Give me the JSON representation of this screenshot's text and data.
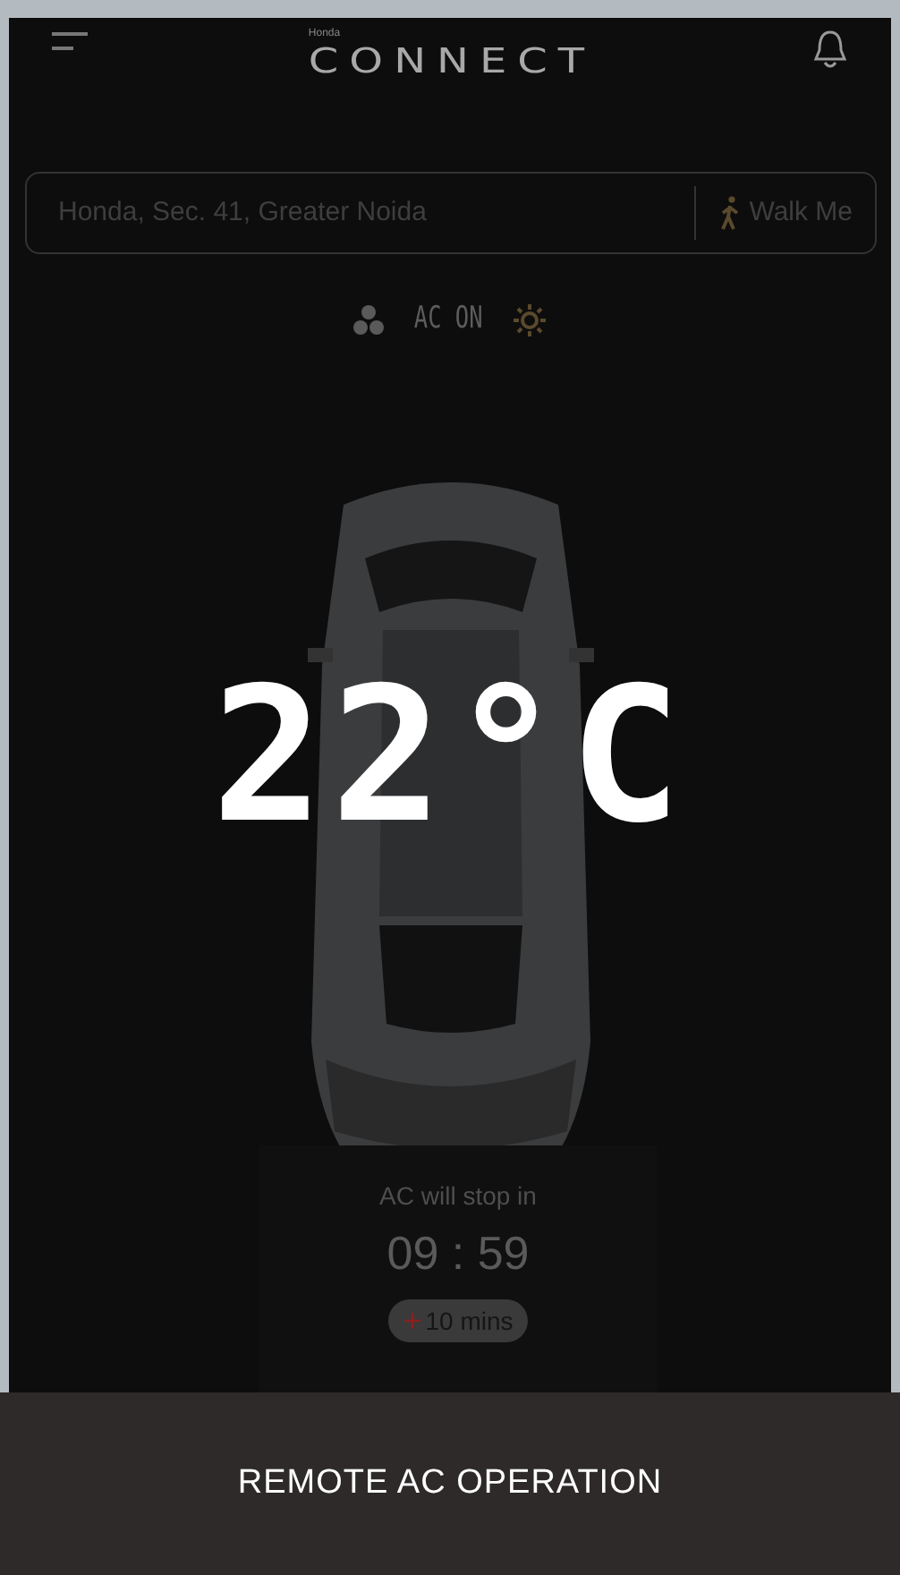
{
  "header": {
    "logo_small": "Honda",
    "logo": "CONNECT"
  },
  "location": {
    "address": "Honda, Sec. 41, Greater Noida",
    "walk_label": "Walk Me"
  },
  "ac_status": {
    "label": "AC ON",
    "on": true
  },
  "temperature": "22°C",
  "timer": {
    "label": "AC will stop in",
    "time": "09 : 59",
    "extend_sign": "+",
    "extend_label": "10 mins"
  },
  "caption": "REMOTE AC OPERATION"
}
